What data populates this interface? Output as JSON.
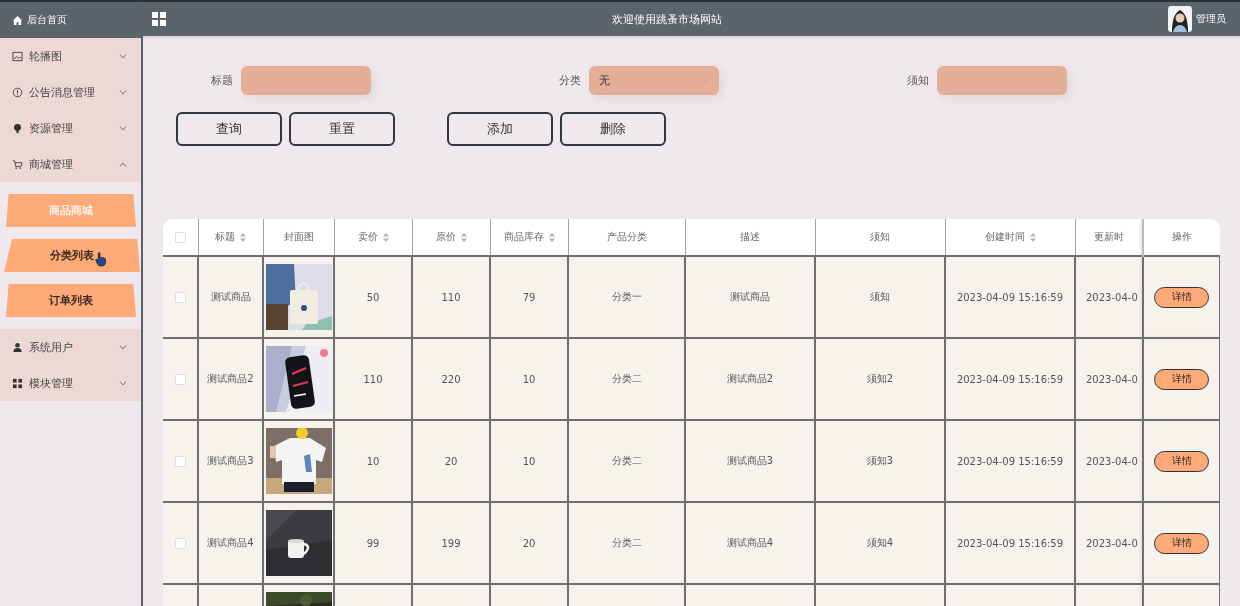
{
  "sidebar": {
    "home": "后台首页",
    "items": [
      {
        "label": "轮播图",
        "expanded": false
      },
      {
        "label": "公告消息管理",
        "expanded": false
      },
      {
        "label": "资源管理",
        "expanded": false
      },
      {
        "label": "商城管理",
        "expanded": true,
        "children": [
          {
            "label": "商品商城",
            "selected": true
          },
          {
            "label": "分类列表",
            "selected": false
          },
          {
            "label": "订单列表",
            "selected": false
          }
        ]
      },
      {
        "label": "系统用户",
        "expanded": false
      },
      {
        "label": "模块管理",
        "expanded": false
      }
    ]
  },
  "header": {
    "title": "欢迎使用跳蚤市场网站",
    "user": "管理员"
  },
  "filters": [
    {
      "label": "标题"
    },
    {
      "label": "分类",
      "value": "无",
      "kind": "select"
    },
    {
      "label": "须知"
    }
  ],
  "buttons": [
    "查询",
    "重置",
    "添加",
    "删除"
  ],
  "table": {
    "select_all": false,
    "columns": [
      {
        "label": "标题",
        "sortable": true
      },
      {
        "label": "封面图",
        "sortable": false
      },
      {
        "label": "卖价",
        "sortable": true
      },
      {
        "label": "原价",
        "sortable": true
      },
      {
        "label": "商品库存",
        "sortable": true
      },
      {
        "label": "产品分类",
        "sortable": false
      },
      {
        "label": "描述",
        "sortable": false
      },
      {
        "label": "须知",
        "sortable": false
      },
      {
        "label": "创建时间",
        "sortable": true
      },
      {
        "label": "更新时",
        "sortable": false
      },
      {
        "label": "操作",
        "sortable": false
      }
    ],
    "rows": [
      {
        "checked": false,
        "title": "测试商品",
        "cover": {
          "kind": "picture"
        },
        "cells": [
          "50",
          "110",
          "79",
          "分类一",
          "测试商品",
          "须知",
          "2023-04-09 15:16:59",
          "2023-04-0"
        ],
        "action": "详情"
      },
      {
        "checked": false,
        "title": "测试商品2",
        "cover": {
          "kind": "picture"
        },
        "cells": [
          "110",
          "220",
          "10",
          "分类二",
          "测试商品2",
          "须知2",
          "2023-04-09 15:16:59",
          "2023-04-0"
        ],
        "action": "详情"
      },
      {
        "checked": false,
        "title": "测试商品3",
        "cover": {
          "kind": "picture"
        },
        "cells": [
          "10",
          "20",
          "10",
          "分类二",
          "测试商品3",
          "须知3",
          "2023-04-09 15:16:59",
          "2023-04-0"
        ],
        "action": "详情"
      },
      {
        "checked": false,
        "title": "测试商品4",
        "cover": {
          "kind": "picture"
        },
        "cells": [
          "99",
          "199",
          "20",
          "分类二",
          "测试商品4",
          "须知4",
          "2023-04-09 15:16:59",
          "2023-04-0"
        ],
        "action": "详情"
      },
      {
        "cover": {
          "kind": "picture"
        }
      }
    ]
  }
}
